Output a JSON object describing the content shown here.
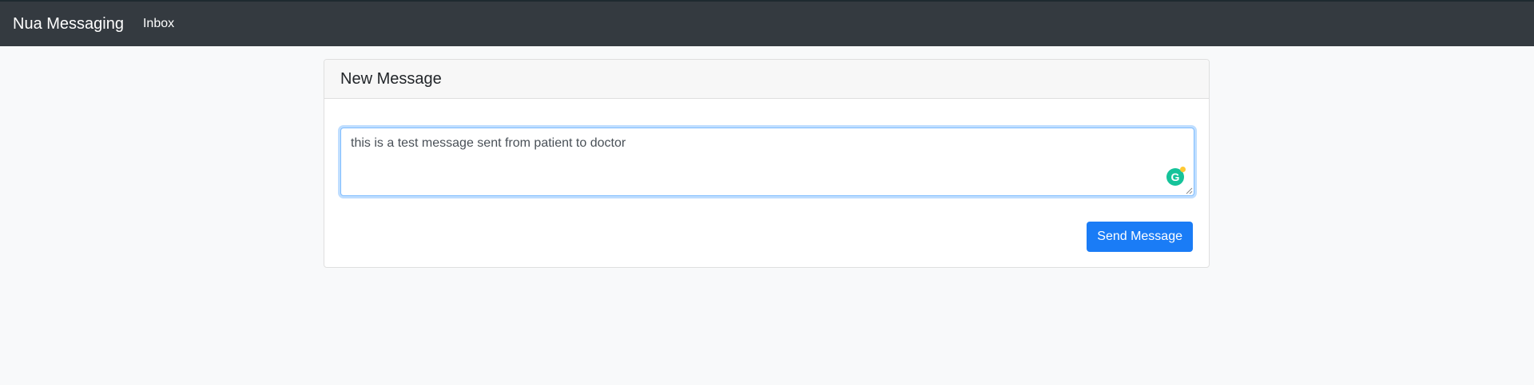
{
  "navbar": {
    "brand": "Nua Messaging",
    "links": [
      {
        "label": "Inbox"
      }
    ],
    "background": "#343a40"
  },
  "card": {
    "title": "New Message",
    "message": {
      "value": "this is a test message sent from patient to doctor",
      "focused": true
    },
    "grammarly_icon": "grammarly-icon",
    "send_label": "Send Message",
    "accent": "#1a7cf6"
  }
}
